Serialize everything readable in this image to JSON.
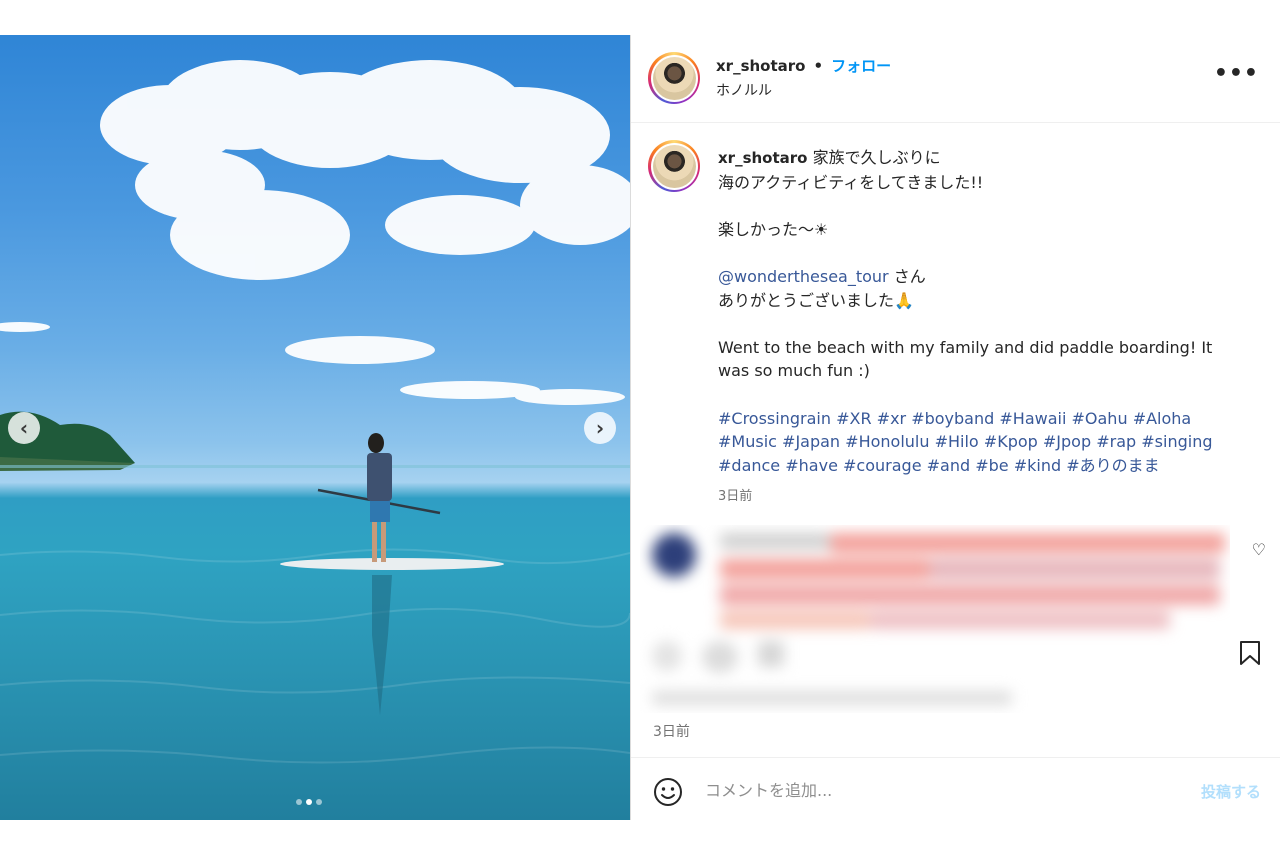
{
  "post": {
    "username": "xr_shotaro",
    "separator": "•",
    "follow_label": "フォロー",
    "location": "ホノルル",
    "more_icon": "more-options-icon"
  },
  "caption": {
    "username": "xr_shotaro",
    "line1": "家族で久しぶりに",
    "line2": "海のアクティビティをしてきました!!",
    "line3": "楽しかった〜☀",
    "mention": "@wonderthesea_tour",
    "mention_suffix": " さん",
    "line5": "ありがとうございました🙏",
    "english_line1": "Went to the beach with my family and did paddle boarding! It",
    "english_line2": "was so much fun :)",
    "hashtags_line1": [
      "#Crossingrain",
      "#XR",
      "#xr",
      "#boyband",
      "#Hawaii",
      "#Oahu",
      "#Aloha"
    ],
    "hashtags_line2": [
      "#Music",
      "#Japan",
      "#Honolulu",
      "#Hilo",
      "#Kpop",
      "#Jpop",
      "#rap",
      "#singing"
    ],
    "hashtags_line3": [
      "#dance",
      "#have",
      "#courage",
      "#and",
      "#be",
      "#kind",
      "#ありのまま"
    ],
    "time": "3日前"
  },
  "comment": {
    "blurred": true,
    "time": "3日前"
  },
  "carousel": {
    "prev_icon": "chevron-left-icon",
    "next_icon": "chevron-right-icon",
    "prev_glyph": "‹",
    "next_glyph": "›",
    "slide_count": 3,
    "active_slide": 2
  },
  "add_comment": {
    "placeholder": "コメントを追加...",
    "post_label": "投稿する"
  },
  "colors": {
    "accent": "#0095f6",
    "link": "#385898",
    "muted": "#737373"
  }
}
